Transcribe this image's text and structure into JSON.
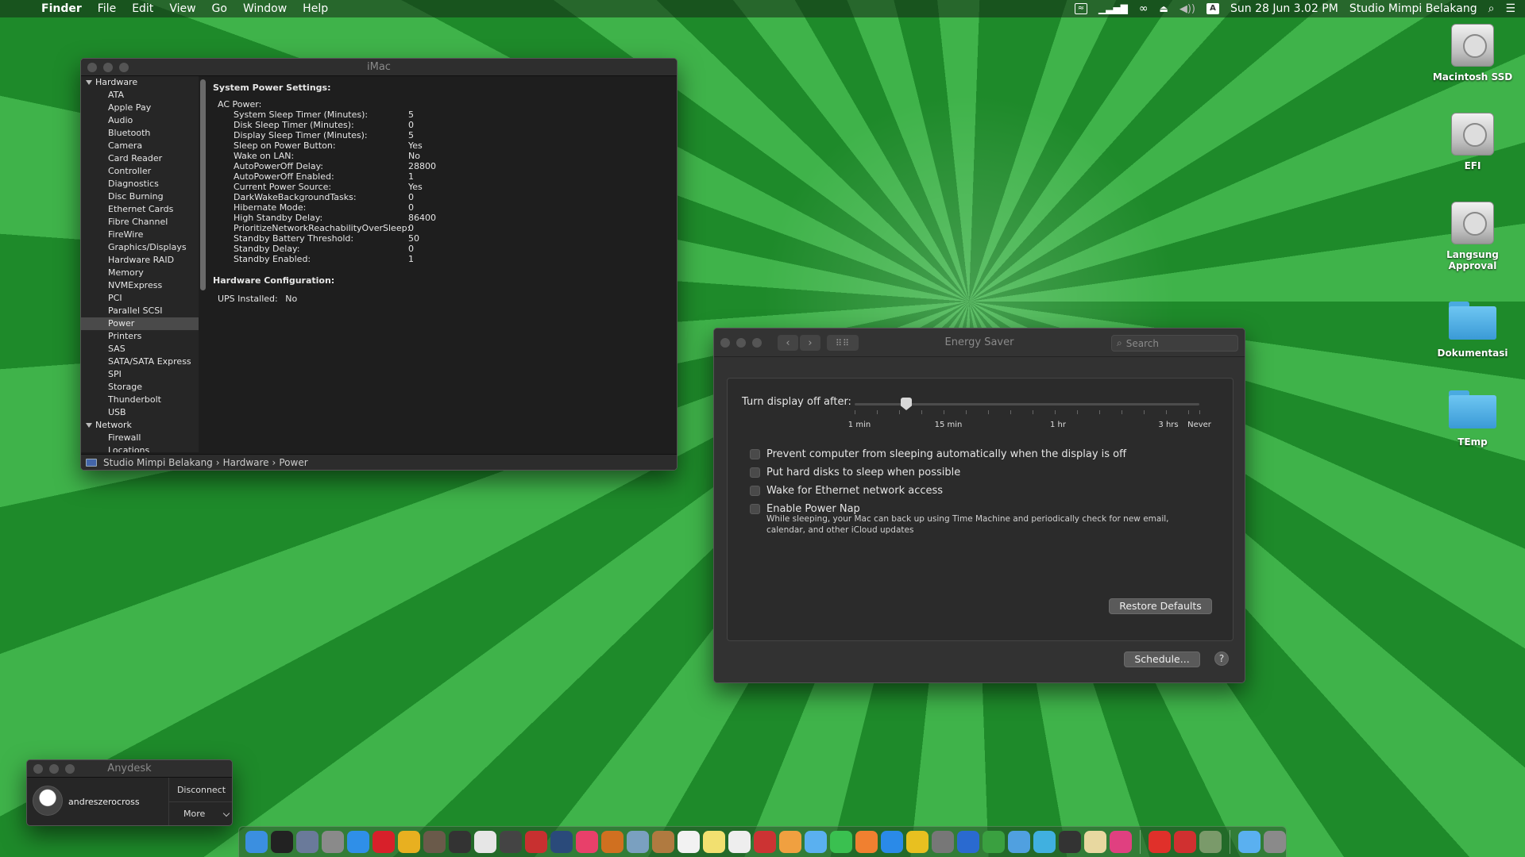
{
  "menubar": {
    "apple": "",
    "items": [
      "Finder",
      "File",
      "Edit",
      "View",
      "Go",
      "Window",
      "Help"
    ],
    "status": {
      "input_source": "A",
      "datetime": "Sun 28 Jun  3.02 PM",
      "user": "Studio Mimpi Belakang"
    }
  },
  "system_info": {
    "title": "iMac",
    "sidebar": [
      {
        "label": "Hardware",
        "group": true
      },
      {
        "label": "ATA"
      },
      {
        "label": "Apple Pay"
      },
      {
        "label": "Audio"
      },
      {
        "label": "Bluetooth"
      },
      {
        "label": "Camera"
      },
      {
        "label": "Card Reader"
      },
      {
        "label": "Controller"
      },
      {
        "label": "Diagnostics"
      },
      {
        "label": "Disc Burning"
      },
      {
        "label": "Ethernet Cards"
      },
      {
        "label": "Fibre Channel"
      },
      {
        "label": "FireWire"
      },
      {
        "label": "Graphics/Displays"
      },
      {
        "label": "Hardware RAID"
      },
      {
        "label": "Memory"
      },
      {
        "label": "NVMExpress"
      },
      {
        "label": "PCI"
      },
      {
        "label": "Parallel SCSI"
      },
      {
        "label": "Power",
        "selected": true
      },
      {
        "label": "Printers"
      },
      {
        "label": "SAS"
      },
      {
        "label": "SATA/SATA Express"
      },
      {
        "label": "SPI"
      },
      {
        "label": "Storage"
      },
      {
        "label": "Thunderbolt"
      },
      {
        "label": "USB"
      },
      {
        "label": "Network",
        "group": true
      },
      {
        "label": "Firewall"
      },
      {
        "label": "Locations"
      }
    ],
    "section_title": "System Power Settings:",
    "ac_power_label": "AC Power:",
    "settings": [
      {
        "k": "System Sleep Timer (Minutes):",
        "v": "5"
      },
      {
        "k": "Disk Sleep Timer (Minutes):",
        "v": "0"
      },
      {
        "k": "Display Sleep Timer (Minutes):",
        "v": "5"
      },
      {
        "k": "Sleep on Power Button:",
        "v": "Yes"
      },
      {
        "k": "Wake on LAN:",
        "v": "No"
      },
      {
        "k": "AutoPowerOff Delay:",
        "v": "28800"
      },
      {
        "k": "AutoPowerOff Enabled:",
        "v": "1"
      },
      {
        "k": "Current Power Source:",
        "v": "Yes"
      },
      {
        "k": "DarkWakeBackgroundTasks:",
        "v": "0"
      },
      {
        "k": "Hibernate Mode:",
        "v": "0"
      },
      {
        "k": "High Standby Delay:",
        "v": "86400"
      },
      {
        "k": "PrioritizeNetworkReachabilityOverSleep:",
        "v": "0"
      },
      {
        "k": "Standby Battery Threshold:",
        "v": "50"
      },
      {
        "k": "Standby Delay:",
        "v": "0"
      },
      {
        "k": "Standby Enabled:",
        "v": "1"
      }
    ],
    "hw_title": "Hardware Configuration:",
    "ups_label": "UPS Installed:",
    "ups_value": "No",
    "path": [
      "Studio Mimpi Belakang",
      "Hardware",
      "Power"
    ]
  },
  "energy_saver": {
    "title": "Energy Saver",
    "search_placeholder": "Search",
    "display_off_label": "Turn display off after:",
    "slider_ticks": [
      "1 min",
      "15 min",
      "1 hr",
      "3 hrs",
      "Never"
    ],
    "slider_value": "5 min",
    "checkboxes": [
      {
        "label": "Prevent computer from sleeping automatically when the display is off",
        "checked": false
      },
      {
        "label": "Put hard disks to sleep when possible",
        "checked": false
      },
      {
        "label": "Wake for Ethernet network access",
        "checked": false
      },
      {
        "label": "Enable Power Nap",
        "checked": false
      }
    ],
    "power_nap_desc": "While sleeping, your Mac can back up using Time Machine and periodically check for new email, calendar, and other iCloud updates",
    "restore_label": "Restore Defaults",
    "schedule_label": "Schedule...",
    "help_label": "?"
  },
  "anydesk": {
    "title": "Anydesk",
    "user": "andreszerocross",
    "disconnect": "Disconnect",
    "more": "More"
  },
  "desktop_icons": [
    {
      "label": "Macintosh SSD",
      "kind": "disk"
    },
    {
      "label": "EFI",
      "kind": "disk"
    },
    {
      "label": "Langsung Approval",
      "kind": "disk"
    },
    {
      "label": "Dokumentasi",
      "kind": "folder"
    },
    {
      "label": "TEmp",
      "kind": "folder"
    }
  ],
  "dock": {
    "apps": [
      {
        "name": "finder",
        "color": "#3b8fe0"
      },
      {
        "name": "terminal",
        "color": "#222222"
      },
      {
        "name": "launchpad",
        "color": "#6a7a9a"
      },
      {
        "name": "rocket",
        "color": "#8a8a8a"
      },
      {
        "name": "safari",
        "color": "#2f8fe8"
      },
      {
        "name": "opera",
        "color": "#d8202a"
      },
      {
        "name": "chrome",
        "color": "#e8b020"
      },
      {
        "name": "photo-editor",
        "color": "#6a5a4a"
      },
      {
        "name": "live",
        "color": "#333333"
      },
      {
        "name": "browser",
        "color": "#e6e6e6"
      },
      {
        "name": "disk-utility",
        "color": "#444444"
      },
      {
        "name": "arrow-app",
        "color": "#c83030"
      },
      {
        "name": "sound-app",
        "color": "#2a4a7a"
      },
      {
        "name": "music",
        "color": "#e8406a"
      },
      {
        "name": "mountain-app",
        "color": "#d07020"
      },
      {
        "name": "preview",
        "color": "#7aa0c0"
      },
      {
        "name": "notes-book",
        "color": "#b07a40"
      },
      {
        "name": "calendar",
        "color": "#f2f2f2"
      },
      {
        "name": "stickies",
        "color": "#f2e070"
      },
      {
        "name": "text-edit",
        "color": "#eeeeee"
      },
      {
        "name": "photo-booth",
        "color": "#cc3333"
      },
      {
        "name": "photos",
        "color": "#f0a040"
      },
      {
        "name": "messages",
        "color": "#5ab0f0"
      },
      {
        "name": "facetime",
        "color": "#3ac050"
      },
      {
        "name": "books",
        "color": "#f08030"
      },
      {
        "name": "app-store",
        "color": "#2a8ae8"
      },
      {
        "name": "norton",
        "color": "#e8c020"
      },
      {
        "name": "system-prefs",
        "color": "#777777"
      },
      {
        "name": "utility-blue",
        "color": "#2a6ad0"
      },
      {
        "name": "cloud-app",
        "color": "#3aa040"
      },
      {
        "name": "itunes",
        "color": "#50a0e0"
      },
      {
        "name": "network-app",
        "color": "#40b0e0"
      },
      {
        "name": "clapper",
        "color": "#333333"
      },
      {
        "name": "archive",
        "color": "#e8d8a0"
      },
      {
        "name": "pink-app",
        "color": "#e04080"
      },
      {
        "name": "anydesk-app",
        "color": "#e0302a"
      },
      {
        "name": "remote-app",
        "color": "#d03030"
      },
      {
        "name": "pyramid-app",
        "color": "#7a9a6a"
      },
      {
        "name": "downloads",
        "color": "#5ab0f0"
      },
      {
        "name": "trash",
        "color": "#8a8a8a"
      }
    ]
  }
}
